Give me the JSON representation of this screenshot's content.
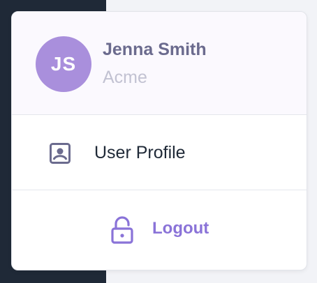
{
  "colors": {
    "sidebar": "#1f2937",
    "avatar_bg": "#a98fdc",
    "accent": "#8a73d8",
    "name_text": "#6b6b8e",
    "org_text": "#c2c2d2"
  },
  "user": {
    "initials": "JS",
    "name": "Jenna Smith",
    "organization": "Acme"
  },
  "menu": {
    "profile": {
      "label": "User Profile",
      "icon": "user-profile-icon"
    },
    "logout": {
      "label": "Logout",
      "icon": "unlock-icon"
    }
  }
}
